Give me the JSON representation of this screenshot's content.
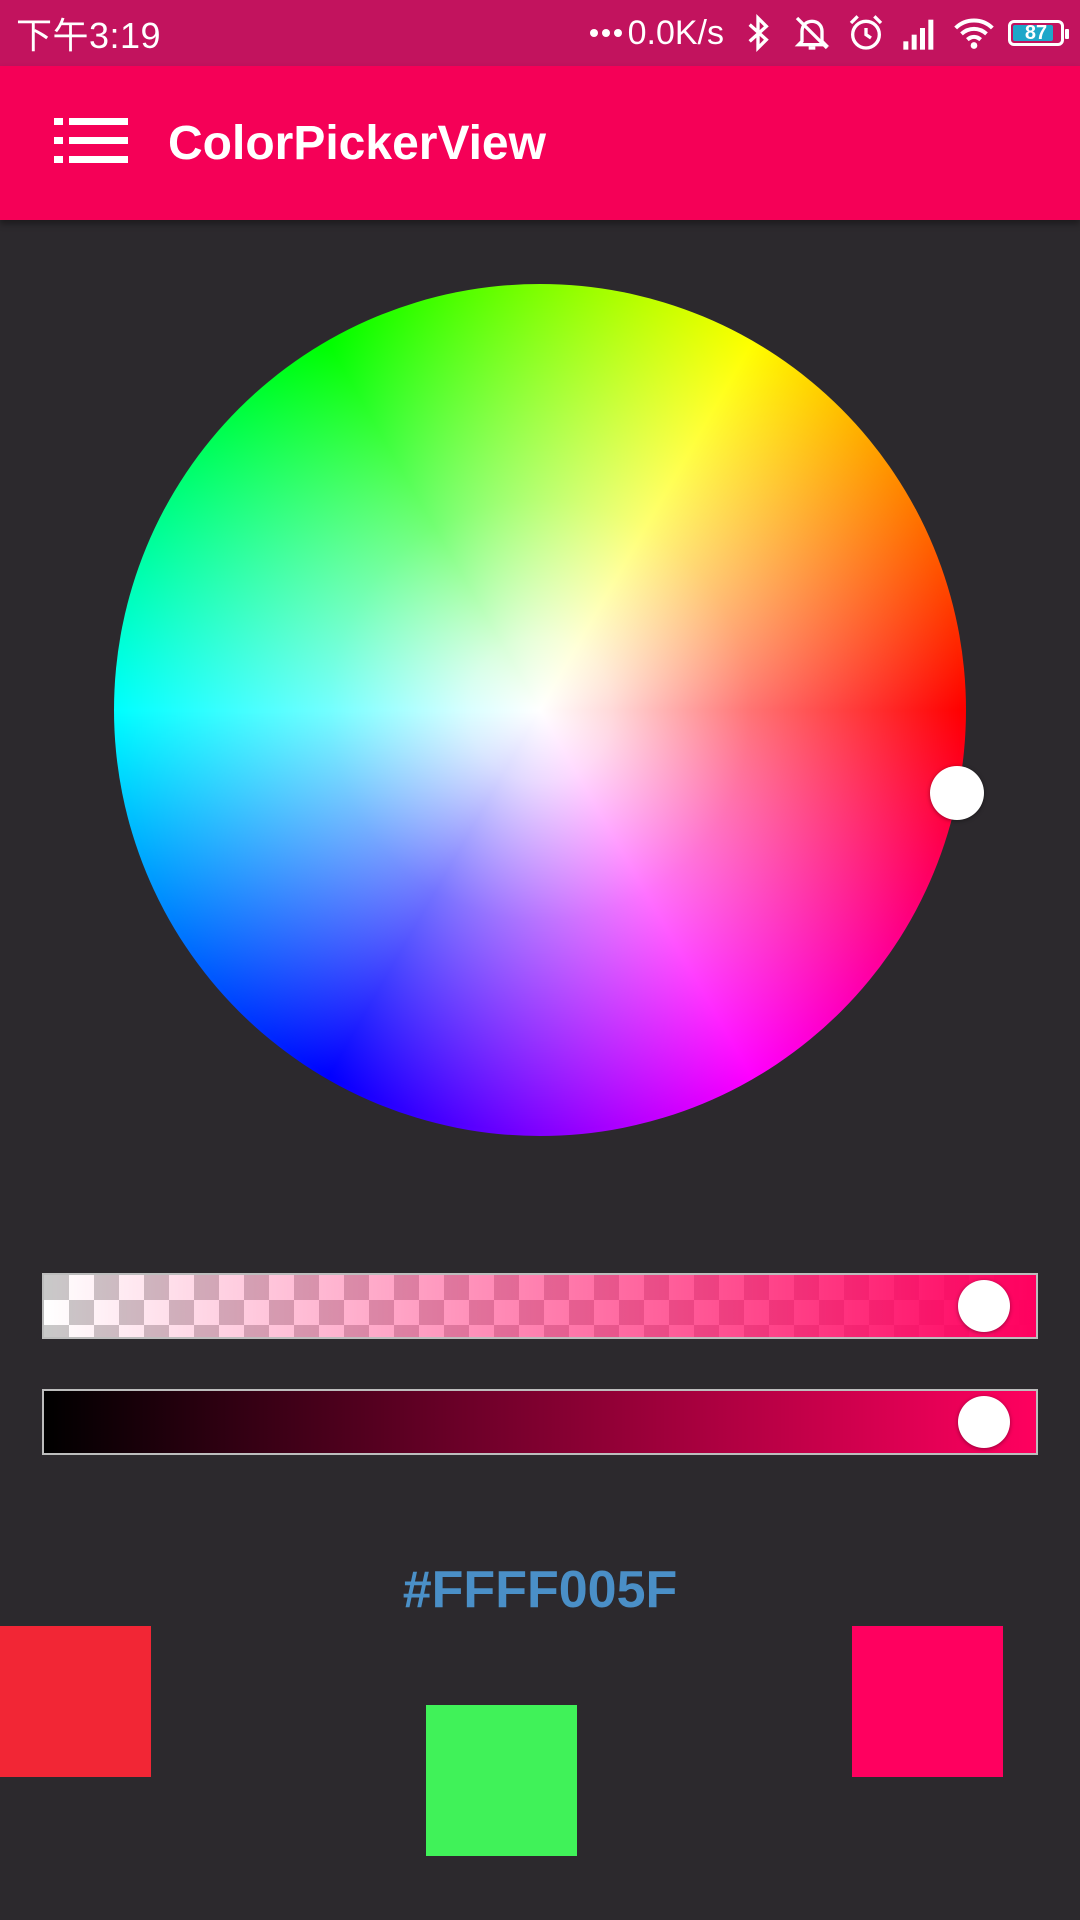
{
  "status_bar": {
    "time": "下午3:19",
    "net_speed": "0.0K/s",
    "battery": "87",
    "battery_level": 87,
    "icons": [
      "bluetooth-icon",
      "mute-icon",
      "alarm-icon",
      "signal-icon",
      "wifi-icon",
      "battery-icon"
    ]
  },
  "app_bar": {
    "title": "ColorPickerView",
    "menu_icon": "menu-list-icon"
  },
  "picker": {
    "selected_color": "#FF005F",
    "alpha_level": 1.0,
    "brightness_level": 1.0
  },
  "hex_label": "#FFFF005F",
  "swatches": [
    {
      "name": "red",
      "color": "#F22635"
    },
    {
      "name": "green",
      "color": "#40F259"
    },
    {
      "name": "pink",
      "color": "#FF005F"
    }
  ],
  "colors": {
    "status_bar": "#C2135E",
    "app_bar": "#F50057",
    "background": "#2C292D",
    "hex_text": "#4A8FC7"
  }
}
